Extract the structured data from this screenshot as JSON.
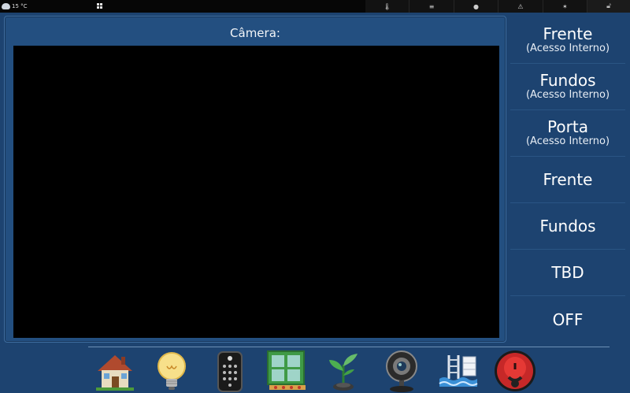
{
  "taskbar": {
    "temperature": "15 °C",
    "tray_icons": [
      "thermometer-icon",
      "sliders-icon",
      "brightness-icon",
      "warning-icon",
      "sun-icon"
    ],
    "lock_icon": "lock-icon"
  },
  "camera": {
    "title": "Câmera:"
  },
  "menu": {
    "items": [
      {
        "label": "Frente",
        "sub": "(Acesso Interno)"
      },
      {
        "label": "Fundos",
        "sub": "(Acesso Interno)"
      },
      {
        "label": "Porta",
        "sub": "(Acesso Interno)"
      },
      {
        "label": "Frente",
        "sub": ""
      },
      {
        "label": "Fundos",
        "sub": ""
      },
      {
        "label": "TBD",
        "sub": ""
      },
      {
        "label": "OFF",
        "sub": ""
      }
    ]
  },
  "dock": {
    "icons": [
      "house-icon",
      "light-bulb-icon",
      "door-lock-keypad-icon",
      "window-icon",
      "plant-sprout-icon",
      "webcam-icon",
      "pool-icon",
      "alarm-button-icon"
    ]
  },
  "colors": {
    "background": "#1d4370",
    "panel": "#234f80",
    "camera_view": "#000000"
  }
}
